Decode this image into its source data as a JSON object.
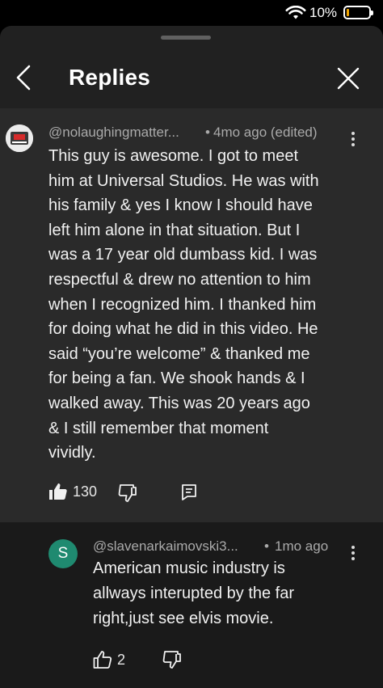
{
  "status": {
    "battery_percent": "10%",
    "battery_color": "#f0a500"
  },
  "header": {
    "title": "Replies",
    "back_icon": "chevron-left-icon",
    "close_icon": "close-icon"
  },
  "parent_comment": {
    "author": "@nolaughingmatter...",
    "time": "4mo ago (edited)",
    "lines": [
      "This guy is awesome. I got to meet",
      "him at Universal Studios. He was with",
      "his family & yes I know I should have",
      "left him alone in that situation. But I",
      "was a 17 year old dumbass kid. I was",
      "respectful & drew no attention to him",
      "when I recognized him. I thanked him",
      "for doing what he did in this video. He",
      "said “you’re welcome” & thanked me",
      "for being a fan. We shook hands & I",
      "walked away. This was 20 years ago",
      "& I still remember that moment",
      "vividly."
    ],
    "likes": "130",
    "actions": [
      "thumbs-up-filled-icon",
      "thumbs-down-icon",
      "reply-icon",
      "more-vert-icon"
    ]
  },
  "reply_comment": {
    "avatar_letter": "S",
    "avatar_color": "#1f8a70",
    "author": "@slavenarkaimovski3...",
    "time": "1mo ago",
    "lines": [
      "American music industry is",
      "allways interupted by the far",
      "right,just see elvis movie."
    ],
    "likes": "2",
    "actions": [
      "thumbs-up-icon",
      "thumbs-down-icon",
      "more-vert-icon"
    ]
  }
}
